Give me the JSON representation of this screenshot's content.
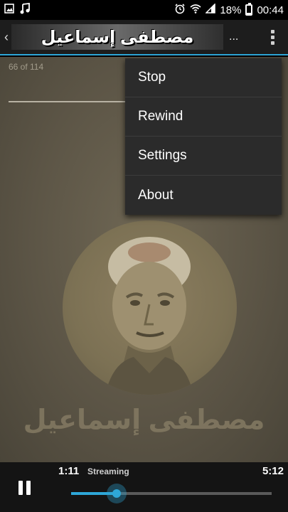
{
  "status_bar": {
    "left_icons": [
      "image-icon",
      "music-note-icon"
    ],
    "right_icons": [
      "alarm-icon",
      "wifi-icon",
      "signal-icon",
      "battery-icon"
    ],
    "battery_percent": "18%",
    "battery_level": 0.18,
    "time": "00:44"
  },
  "app_bar": {
    "title": "مصطفى إسماعيل",
    "ellipsis": "...",
    "back_icon": "chevron-left-icon",
    "overflow_icon": "more-vert-icon"
  },
  "main": {
    "track_count": "66 of 114",
    "watermark_text": "مصطفى إسماعيل"
  },
  "menu": {
    "items": [
      {
        "label": "Stop"
      },
      {
        "label": "Rewind"
      },
      {
        "label": "Settings"
      },
      {
        "label": "About"
      }
    ]
  },
  "player": {
    "elapsed": "1:11",
    "status": "Streaming",
    "duration": "5:12",
    "progress": 0.228,
    "pause_icon": "pause-icon",
    "accent": "#2ea7d8"
  }
}
